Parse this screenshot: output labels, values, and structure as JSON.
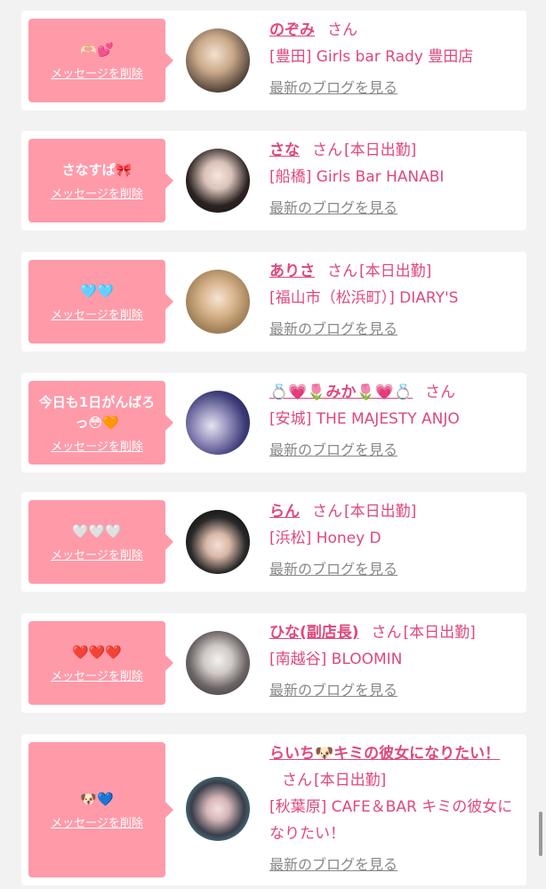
{
  "items": [
    {
      "message": "🫶🏻💕",
      "delete_label": "メッセージを削除",
      "name": "のぞみ",
      "san": "さん",
      "status": "",
      "shop": "[豊田] Girls bar Rady 豊田店",
      "blog_label": "最新のブログを見る"
    },
    {
      "message": "さなすぱ🎀",
      "delete_label": "メッセージを削除",
      "name": "さな",
      "san": "さん",
      "status": "[本日出勤]",
      "shop": "[船橋] Girls Bar HANABI",
      "blog_label": "最新のブログを見る"
    },
    {
      "message": "🩵🩵",
      "delete_label": "メッセージを削除",
      "name": "ありさ",
      "san": "さん",
      "status": "[本日出勤]",
      "shop": "[福山市（松浜町）] DIARY'S",
      "blog_label": "最新のブログを見る"
    },
    {
      "message": "今日も1日がんばろっ😳🧡",
      "delete_label": "メッセージを削除",
      "name": "💍💗🌷みか🌷💗💍",
      "san": "さん",
      "status": "",
      "shop": "[安城] THE MAJESTY ANJO",
      "blog_label": "最新のブログを見る"
    },
    {
      "message": "🤍🤍🤍",
      "delete_label": "メッセージを削除",
      "name": "らん",
      "san": "さん",
      "status": "[本日出勤]",
      "shop": "[浜松] Honey D",
      "blog_label": "最新のブログを見る"
    },
    {
      "message": "❤️❤️❤️",
      "delete_label": "メッセージを削除",
      "name": "ひな(副店長)",
      "san": "さん",
      "status": "[本日出勤]",
      "shop": "[南越谷] BLOOMIN",
      "blog_label": "最新のブログを見る"
    },
    {
      "message": "🐶💙",
      "delete_label": "メッセージを削除",
      "name": "らいち🐶キミの彼女になりたい！",
      "san": "さん",
      "status": "[本日出勤]",
      "shop": "[秋葉原] CAFE＆BAR キミの彼女になりたい！",
      "blog_label": "最新のブログを見る"
    }
  ],
  "colors": {
    "bubble": "#ff9aa9",
    "accent": "#e0487a",
    "link_gray": "#888888",
    "background": "#f2f2f2"
  }
}
